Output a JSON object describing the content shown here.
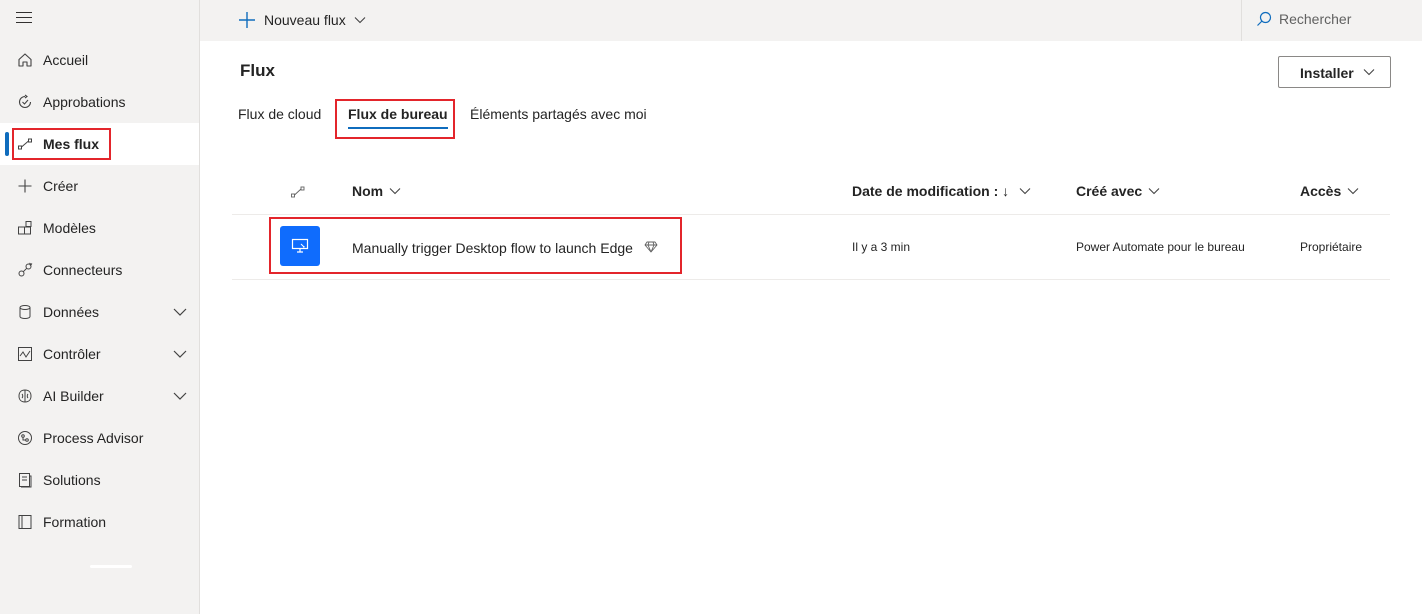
{
  "sidebar": {
    "items": [
      {
        "label": "Accueil",
        "icon": "home-icon"
      },
      {
        "label": "Approbations",
        "icon": "approvals-icon"
      },
      {
        "label": "Mes flux",
        "icon": "flow-icon",
        "active": true
      },
      {
        "label": "Créer",
        "icon": "plus-icon"
      },
      {
        "label": "Modèles",
        "icon": "templates-icon"
      },
      {
        "label": "Connecteurs",
        "icon": "connector-icon"
      },
      {
        "label": "Données",
        "icon": "database-icon",
        "expandable": true
      },
      {
        "label": "Contrôler",
        "icon": "monitor-icon",
        "expandable": true
      },
      {
        "label": "AI Builder",
        "icon": "brain-icon",
        "expandable": true
      },
      {
        "label": "Process Advisor",
        "icon": "process-advisor-icon"
      },
      {
        "label": "Solutions",
        "icon": "solutions-icon"
      },
      {
        "label": "Formation",
        "icon": "book-icon"
      }
    ]
  },
  "topbar": {
    "new_flow_label": "Nouveau flux",
    "search_label": "Rechercher"
  },
  "main": {
    "title": "Flux",
    "install_label": "Installer",
    "tabs": [
      {
        "label": "Flux de cloud"
      },
      {
        "label": "Flux de bureau",
        "active": true
      },
      {
        "label": "Éléments partagés avec moi"
      }
    ],
    "columns": {
      "name": "Nom",
      "modified": "Date de modification : ↓",
      "created_with": "Créé avec",
      "access": "Accès"
    },
    "rows": [
      {
        "name": "Manually trigger Desktop flow to launch Edge",
        "modified": "Il y a 3 min",
        "created_with": "Power Automate pour le bureau",
        "access": "Propriétaire",
        "premium": true
      }
    ]
  },
  "colors": {
    "accent": "#0f6cbd",
    "flow_tile": "#0f6cfd",
    "highlight": "#e3252b"
  }
}
